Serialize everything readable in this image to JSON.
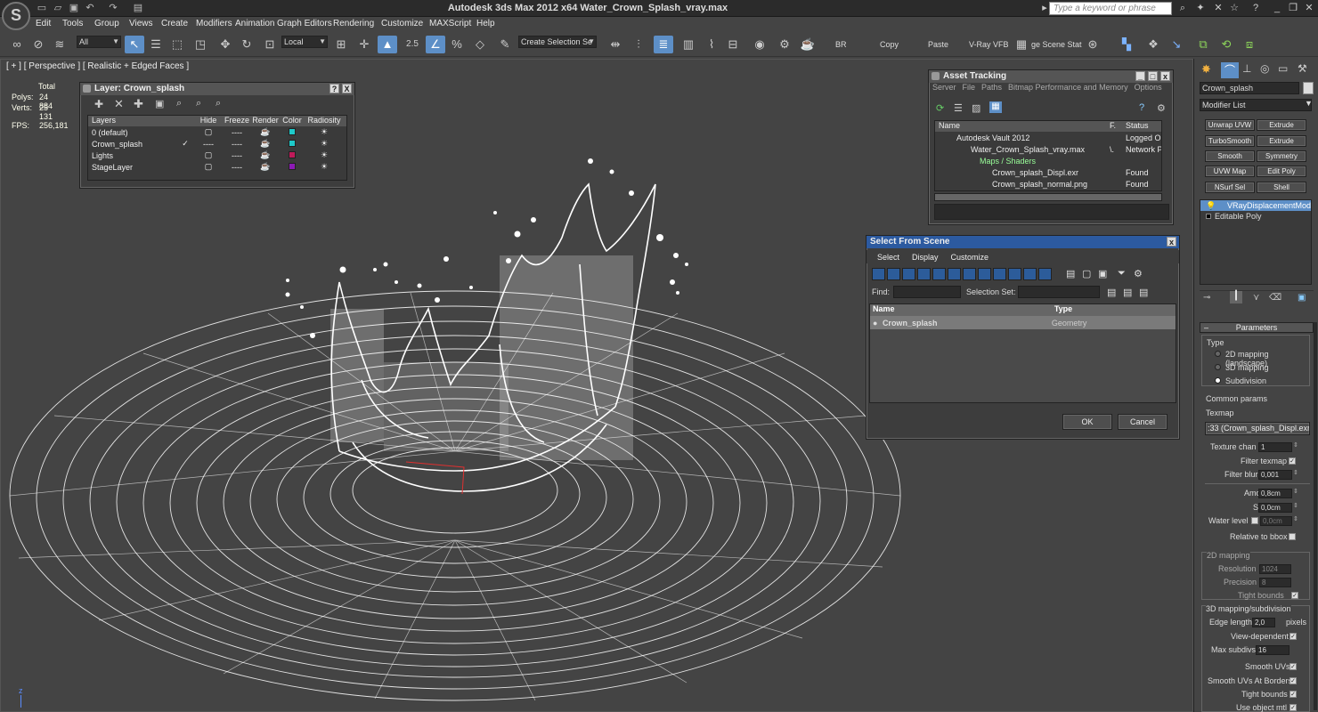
{
  "titlebar": {
    "title": "Autodesk 3ds Max  2012 x64     Water_Crown_Splash_vray.max",
    "search_placeholder": "Type a keyword or phrase"
  },
  "menubar": {
    "items": [
      "Edit",
      "Tools",
      "Group",
      "Views",
      "Create",
      "Modifiers",
      "Animation",
      "Graph Editors",
      "Rendering",
      "Customize",
      "MAXScript",
      "Help"
    ]
  },
  "toolbar": {
    "filter_value": "All",
    "ref_coord_value": "Local",
    "snap_value": "2.5",
    "named_selection_value": "Create Selection Se",
    "br_label": "BR",
    "copy_label": "Copy",
    "paste_label": "Paste",
    "vray_vfb_label": "V-Ray VFB",
    "stat_label": "ge Scene Stat"
  },
  "viewport": {
    "label": "[ + ] [ Perspective ] [ Realistic + Edged Faces ]",
    "stats": {
      "total_label": "Total",
      "polys_label": "Polys:",
      "polys_value": "24 884",
      "verts_label": "Verts:",
      "verts_value": "25 131",
      "fps_label": "FPS:",
      "fps_value": "256,181"
    },
    "axis_z": "z"
  },
  "layer_panel": {
    "title": "Layer: Crown_splash",
    "help": "?",
    "close": "X",
    "columns": [
      "Layers",
      "Hide",
      "Freeze",
      "Render",
      "Color",
      "Radiosity"
    ],
    "rows": [
      {
        "name": "0 (default)",
        "current": "",
        "color": "#1ec9c9"
      },
      {
        "name": "Crown_splash",
        "current": "✓",
        "color": "#1ec9c9"
      },
      {
        "name": "Lights",
        "current": "",
        "color": "#c01a5a"
      },
      {
        "name": "StageLayer",
        "current": "",
        "color": "#8c1ab4"
      }
    ],
    "dash": "----"
  },
  "asset_panel": {
    "title": "Asset Tracking",
    "menu": [
      "Server",
      "File",
      "Paths",
      "Bitmap Performance and Memory",
      "Options"
    ],
    "columns": [
      "Name",
      "F.",
      "Status"
    ],
    "rows": [
      {
        "name": "Autodesk Vault 2012",
        "f": "",
        "status": "Logged O"
      },
      {
        "name": "Water_Crown_Splash_vray.max",
        "f": "\\.",
        "status": "Network P"
      },
      {
        "name": "Maps / Shaders",
        "f": "",
        "status": ""
      },
      {
        "name": "Crown_splash_Displ.exr",
        "f": "",
        "status": "Found"
      },
      {
        "name": "Crown_splash_normal.png",
        "f": "",
        "status": "Found"
      }
    ]
  },
  "select_panel": {
    "title": "Select From Scene",
    "menu": [
      "Select",
      "Display",
      "Customize"
    ],
    "find_label": "Find:",
    "selset_label": "Selection Set:",
    "columns": [
      "Name",
      "Type"
    ],
    "row": {
      "name": "Crown_splash",
      "type": "Geometry"
    },
    "ok": "OK",
    "cancel": "Cancel"
  },
  "cmd_panel": {
    "object_name": "Crown_splash",
    "modifier_list": "Modifier List",
    "buttons": [
      "Unwrap UVW",
      "Extrude",
      "TurboSmooth",
      "Extrude",
      "Smooth",
      "Symmetry",
      "UVW Map",
      "Edit Poly",
      "NSurf Sel",
      "Shell"
    ],
    "stack": [
      "VRayDisplacementMod",
      "Editable Poly"
    ],
    "rollout": "Parameters",
    "type_label": "Type",
    "types": [
      "2D mapping (landscape)",
      "3D mapping",
      "Subdivision"
    ],
    "common_label": "Common params",
    "texmap_label": "Texmap",
    "texmap_value": ":33 (Crown_splash_Displ.exr)",
    "texture_chan_label": "Texture chan",
    "texture_chan_value": "1",
    "filter_texmap_label": "Filter texmap",
    "filter_blur_label": "Filter blur",
    "filter_blur_value": "0,001",
    "amount_label": "Amount",
    "amount_value": "0,8cm",
    "shift_label": "Shift",
    "shift_value": "0,0cm",
    "water_level_label": "Water level",
    "water_level_value": "0,0cm",
    "relative_label": "Relative to bbox",
    "mapping2d_label": "2D mapping",
    "resolution_label": "Resolution",
    "resolution_value": "1024",
    "precision_label": "Precision",
    "precision_value": "8",
    "tight_bounds_label": "Tight bounds",
    "mapping3d_label": "3D mapping/subdivision",
    "edge_length_label": "Edge length",
    "edge_length_value": "2,0",
    "pixels_label": "pixels",
    "view_dependent_label": "View-dependent",
    "max_subdivs_label": "Max subdivs",
    "max_subdivs_value": "16",
    "smooth_uvs_label": "Smooth UVs",
    "smooth_uvs_borders_label": "Smooth UVs At Borders",
    "tight_bounds2_label": "Tight bounds",
    "use_object_mtl_label": "Use object mtl"
  },
  "colors": {
    "selection_blue": "#5d8fc7",
    "title_blue": "#2c5aa0",
    "wireframe": "#ffffff",
    "viewport_bg": "#444444"
  }
}
